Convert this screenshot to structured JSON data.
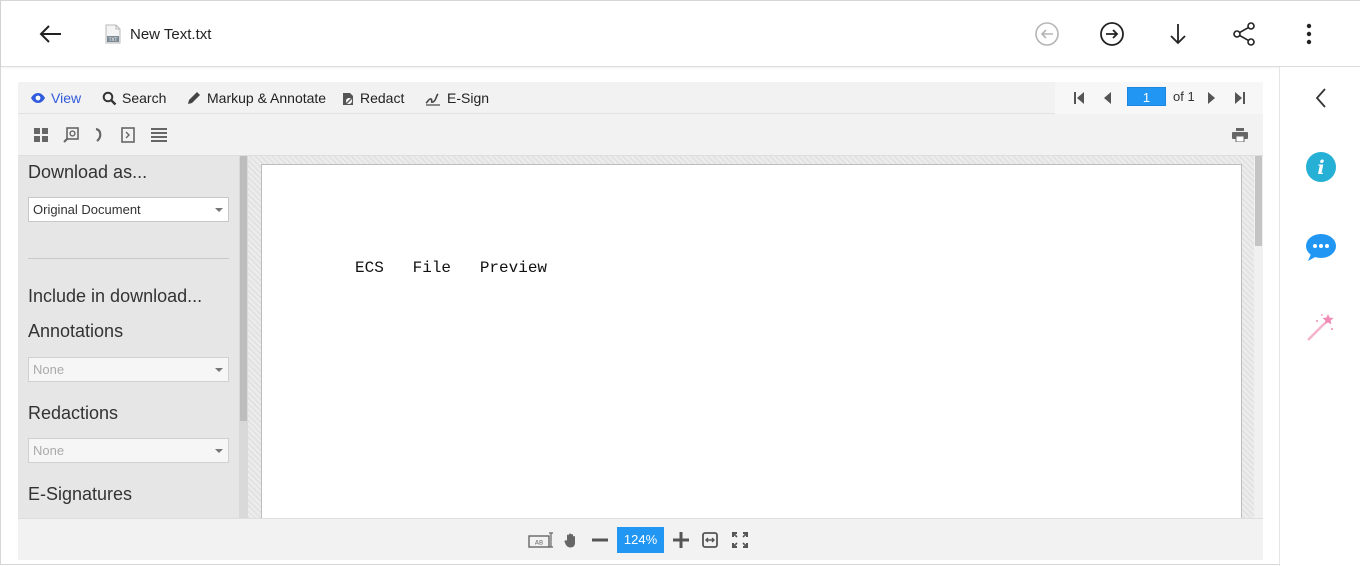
{
  "header": {
    "file_name": "New Text.txt",
    "file_icon": "txt-file-icon",
    "icons": [
      "back-arrow-icon",
      "previous-circle-icon",
      "next-circle-icon",
      "download-icon",
      "share-icon",
      "more-vertical-icon"
    ]
  },
  "toolbar": {
    "view": "View",
    "search": "Search",
    "markup": "Markup & Annotate",
    "redact": "Redact",
    "esign": "E-Sign",
    "page_current": "1",
    "page_of": "of 1"
  },
  "left_panel": {
    "download_as_label": "Download as...",
    "download_as_value": "Original Document",
    "include_label": "Include in download...",
    "annotations_label": "Annotations",
    "annotations_value": "None",
    "redactions_label": "Redactions",
    "redactions_value": "None",
    "esignatures_label": "E-Signatures"
  },
  "document": {
    "text": "ECS   File   Preview"
  },
  "bottom": {
    "zoom": "124%"
  },
  "colors": {
    "accent": "#2196f3",
    "active_text": "#2f5bdc",
    "info": "#26b0d6",
    "chat": "#2196f3",
    "wand": "#f08cb4"
  }
}
